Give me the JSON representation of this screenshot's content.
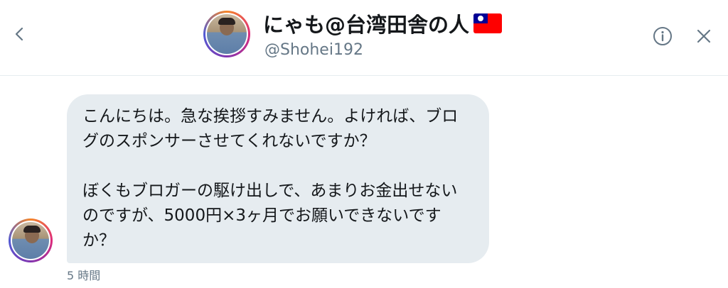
{
  "header": {
    "back_icon": "chevron-left-icon",
    "display_name": "にゃも@台湾田舎の人",
    "flag_emoji": "taiwan-flag-icon",
    "handle": "@Shohei192",
    "info_icon": "info-icon",
    "close_icon": "close-icon"
  },
  "message": {
    "paragraph1": "こんにちは。急な挨拶すみません。よければ、ブログのスポンサーさせてくれないですか？",
    "paragraph2": "ぼくもブロガーの駆け出しで、あまりお金出せないのですが、5000円×3ヶ月でお願いできないですか？",
    "timestamp": "5 時間"
  },
  "colors": {
    "bubble_bg": "#e6ecf0",
    "secondary_text": "#657786",
    "icon": "#657786"
  }
}
